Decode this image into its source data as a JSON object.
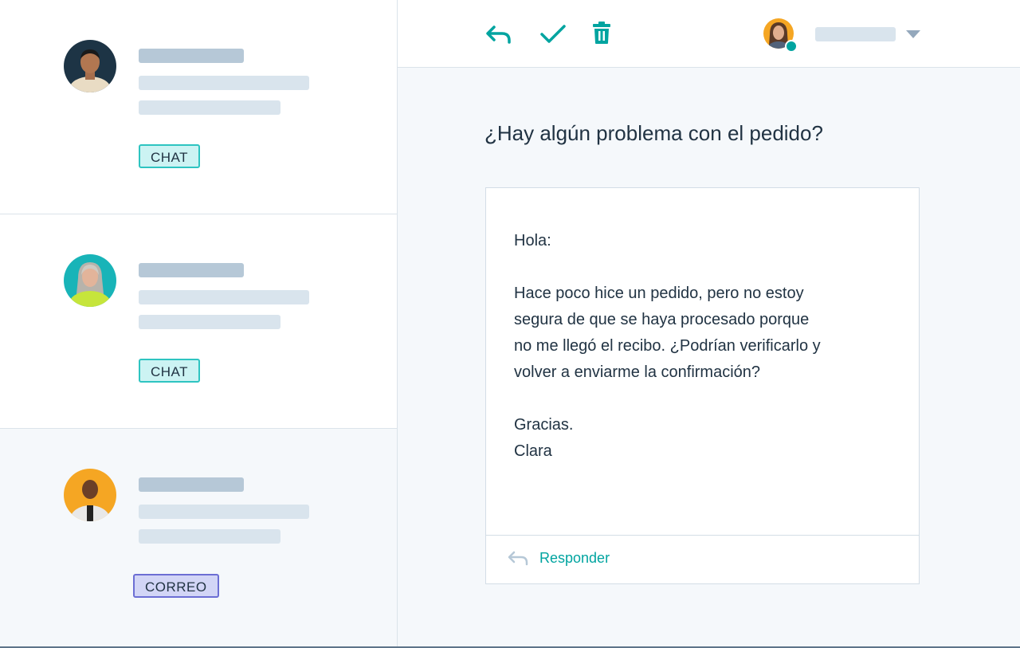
{
  "inbox": {
    "conversations": [
      {
        "channel_tag": "CHAT",
        "tag_type": "chat",
        "avatar_bg": "#1d3445",
        "avatar_shirt": "#e9dcc4",
        "selected": false
      },
      {
        "channel_tag": "CHAT",
        "tag_type": "chat",
        "avatar_bg": "#18b4b8",
        "avatar_shirt": "#c6e53b",
        "selected": false
      },
      {
        "channel_tag": "CORREO",
        "tag_type": "email",
        "avatar_bg": "#f5a623",
        "avatar_shirt": "#e8e8e8",
        "selected": true
      }
    ]
  },
  "toolbar": {
    "reply_icon": "reply-arrow-icon",
    "done_icon": "checkmark-icon",
    "delete_icon": "trash-icon",
    "agent_status": "online"
  },
  "message": {
    "subject": "¿Hay algún problema con el pedido?",
    "greeting": "Hola:",
    "body_lines": [
      "Hace poco hice un pedido, pero no estoy",
      "segura de que se haya procesado porque",
      "no me llegó el recibo. ¿Podrían verificarlo y",
      "volver a enviarme la confirmación?"
    ],
    "closing": "Gracias.",
    "signature": "Clara",
    "reply_label": "Responder"
  },
  "colors": {
    "accent": "#00a4a0",
    "chat_tag_bg": "#ccf3f3",
    "email_tag_bg": "#d2d5f6",
    "text": "#213343"
  }
}
